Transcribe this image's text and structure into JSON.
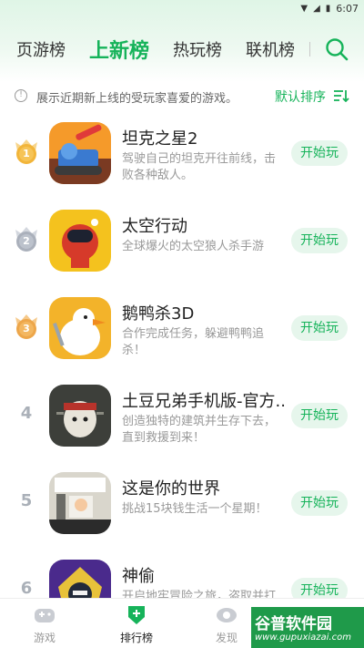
{
  "status_bar": {
    "time": "6:07"
  },
  "tabs": [
    {
      "label": "页游榜",
      "active": false
    },
    {
      "label": "上新榜",
      "active": true
    },
    {
      "label": "热玩榜",
      "active": false
    },
    {
      "label": "联机榜",
      "active": false
    }
  ],
  "info": {
    "text": "展示近期新上线的受玩家喜爱的游戏。",
    "sort_label": "默认排序"
  },
  "games": [
    {
      "rank": "1",
      "name": "坦克之星2",
      "desc": "驾驶自己的坦克开往前线，击败各种敌人。",
      "button": "开始玩"
    },
    {
      "rank": "2",
      "name": "太空行动",
      "desc": "全球爆火的太空狼人杀手游",
      "button": "开始玩"
    },
    {
      "rank": "3",
      "name": "鹅鸭杀3D",
      "desc": "合作完成任务，躲避鸭鸭追杀！",
      "button": "开始玩"
    },
    {
      "rank": "4",
      "name": "土豆兄弟手机版-官方...",
      "desc": "创造独特的建筑并生存下去，直到救援到来！",
      "button": "开始玩"
    },
    {
      "rank": "5",
      "name": "这是你的世界",
      "desc": "挑战15块钱生活一个星期！",
      "button": "开始玩"
    },
    {
      "rank": "6",
      "name": "神偷",
      "desc": "开启地牢冒险之旅，盗取并打造专属宝石",
      "button": "开始玩"
    }
  ],
  "bottom_nav": [
    {
      "label": "游戏",
      "active": false
    },
    {
      "label": "排行榜",
      "active": true
    },
    {
      "label": "发现",
      "active": false
    }
  ],
  "watermark": {
    "title": "谷普软件园",
    "url": "www.gupuxiazai.com"
  },
  "colors": {
    "accent": "#16b35a",
    "button_bg": "#e6f6ec",
    "gold": "#f2b53a",
    "silver": "#aab0bb"
  }
}
